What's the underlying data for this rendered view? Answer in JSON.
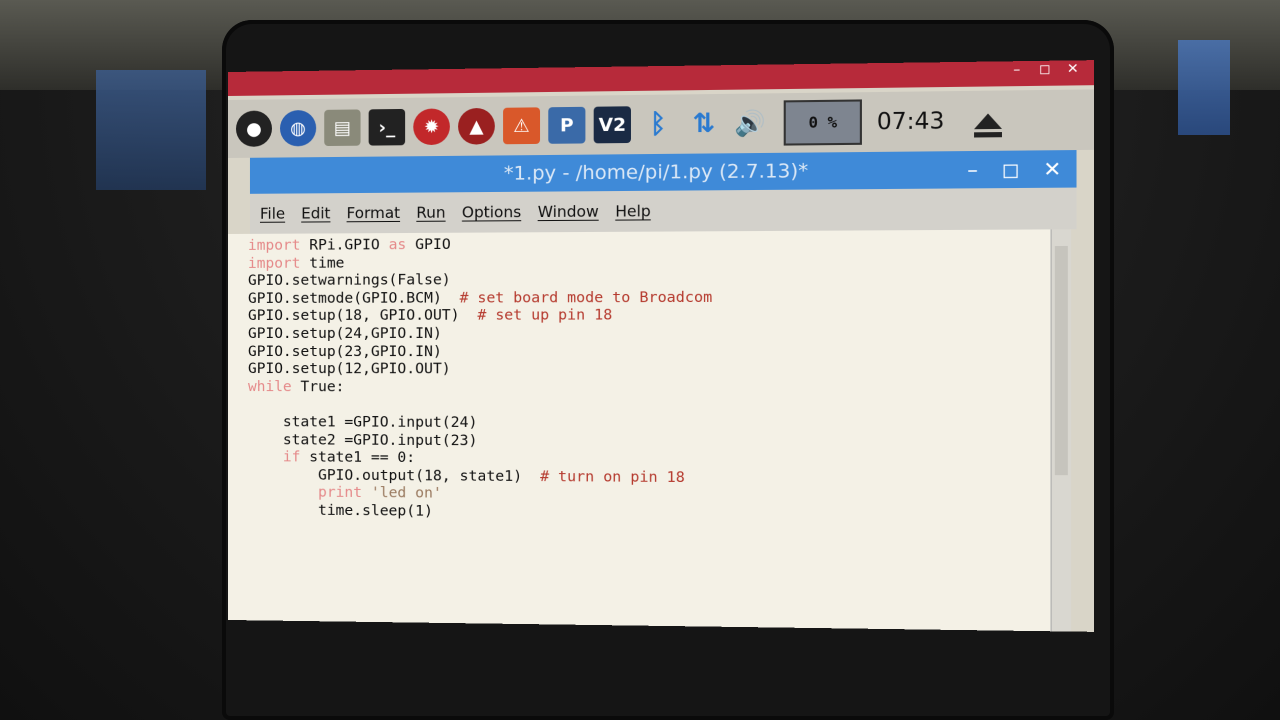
{
  "window_controls": {
    "minimize": "–",
    "maximize": "◻",
    "close": "✕"
  },
  "taskbar": {
    "icons": [
      "raspberry-icon",
      "globe-icon",
      "files-icon",
      "terminal-icon",
      "mathematica-icon",
      "wolfram-icon",
      "warning-icon",
      "python-icon",
      "vnc-icon",
      "bluetooth-icon",
      "network-icon",
      "volume-icon"
    ],
    "vnc_label": "V2",
    "cpu": "0 %",
    "clock": "07:43"
  },
  "editor_window": {
    "title": "*1.py - /home/pi/1.py (2.7.13)*"
  },
  "menu": [
    "File",
    "Edit",
    "Format",
    "Run",
    "Options",
    "Window",
    "Help"
  ],
  "code": [
    {
      "kw": "import",
      "rest": " RPi.GPIO ",
      "kw2": "as",
      "rest2": " GPIO",
      "comment": ""
    },
    {
      "kw": "import",
      "rest": " time",
      "comment": ""
    },
    {
      "kw": "",
      "rest": "GPIO.setwarnings(False)",
      "comment": ""
    },
    {
      "kw": "",
      "rest": "GPIO.setmode(GPIO.BCM)  ",
      "comment": "# set board mode to Broadcom"
    },
    {
      "kw": "",
      "rest": "GPIO.setup(18, GPIO.OUT)  ",
      "comment": "# set up pin 18"
    },
    {
      "kw": "",
      "rest": "GPIO.setup(24,GPIO.IN)",
      "comment": ""
    },
    {
      "kw": "",
      "rest": "GPIO.setup(23,GPIO.IN)",
      "comment": ""
    },
    {
      "kw": "",
      "rest": "GPIO.setup(12,GPIO.OUT)",
      "comment": ""
    },
    {
      "kw": "while",
      "rest": " True:",
      "comment": ""
    },
    {
      "kw": "",
      "rest": "",
      "comment": ""
    },
    {
      "kw": "",
      "rest": "    state1 =GPIO.input(24)",
      "comment": ""
    },
    {
      "kw": "",
      "rest": "    state2 =GPIO.input(23)",
      "comment": ""
    },
    {
      "indent": "    ",
      "kw": "if",
      "rest": " state1 == 0:",
      "comment": ""
    },
    {
      "kw": "",
      "rest": "        GPIO.output(18, state1)  ",
      "comment": "# turn on pin 18"
    },
    {
      "indent": "        ",
      "kw": "print",
      "rest": " ",
      "str": "'led on'",
      "comment": ""
    },
    {
      "kw": "",
      "rest": "        time.sleep(1)",
      "comment": ""
    }
  ]
}
